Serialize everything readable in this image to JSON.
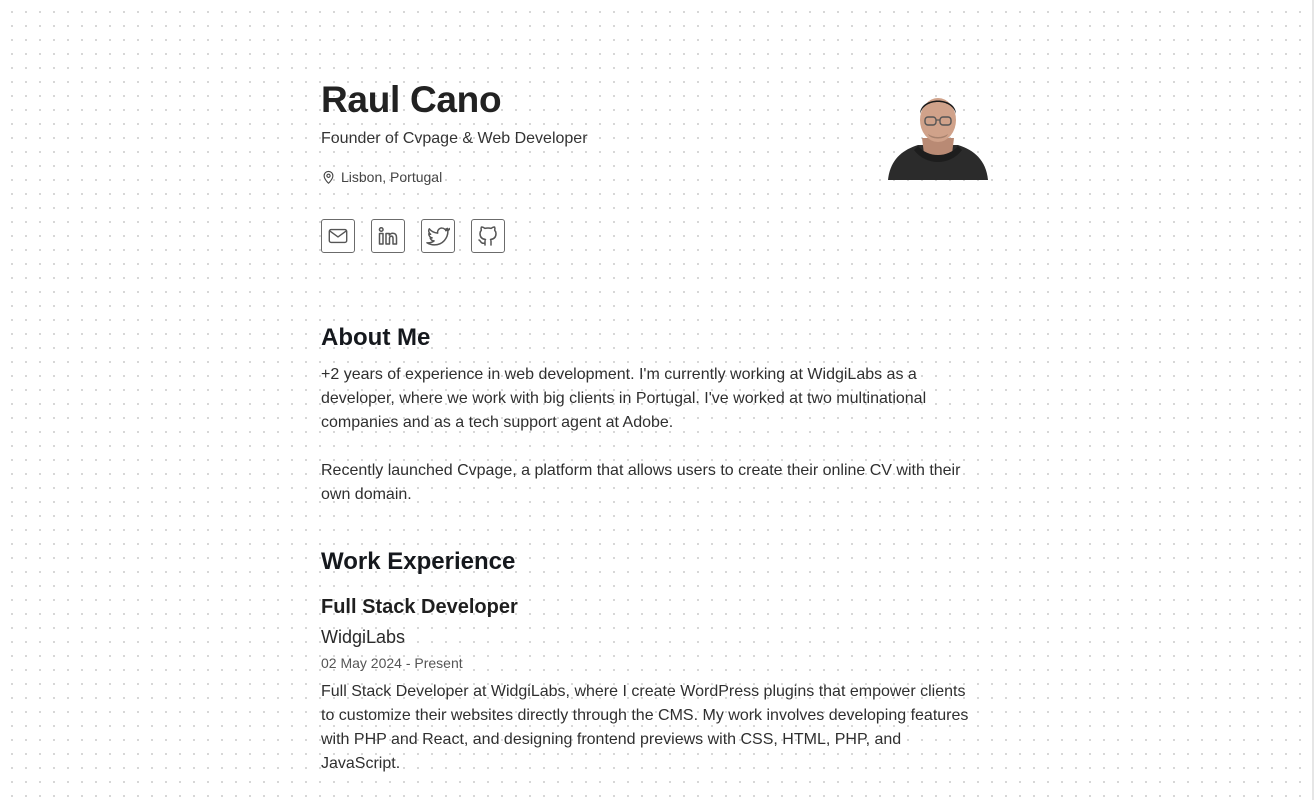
{
  "profile": {
    "name": "Raul Cano",
    "headline": "Founder of Cvpage & Web Developer",
    "location": "Lisbon, Portugal"
  },
  "socials": [
    {
      "icon": "mail-icon"
    },
    {
      "icon": "linkedin-icon"
    },
    {
      "icon": "twitter-icon"
    },
    {
      "icon": "github-icon"
    }
  ],
  "about": {
    "title": "About Me",
    "paragraph1": "+2 years of experience in web development. I'm currently working at WidgiLabs as a developer, where we work with big clients in Portugal. I've worked at two multinational companies and as a tech support agent at Adobe.",
    "paragraph2": "Recently launched Cvpage, a platform that allows users to create their online CV with their own domain."
  },
  "work": {
    "title": "Work Experience",
    "jobs": [
      {
        "role": "Full Stack Developer",
        "company": "WidgiLabs",
        "dates": "02 May 2024 - Present",
        "description": "Full Stack Developer at WidgiLabs, where I create WordPress plugins that empower clients to customize their websites directly through the CMS. My work involves developing features with PHP and React, and designing frontend previews with CSS, HTML, PHP, and JavaScript."
      }
    ]
  },
  "colors": {
    "text": "#1f1f1f",
    "heading": "#15181d",
    "muted": "#555555",
    "dot_grid": "#d4d4d4",
    "icon_border": "#6b6b6b"
  }
}
